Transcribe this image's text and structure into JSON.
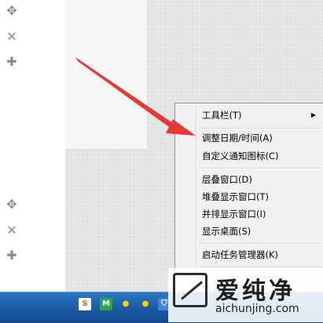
{
  "left_strip": {
    "icons": [
      "move-icon",
      "close-icon",
      "plus-icon",
      "move-icon",
      "close-icon",
      "plus-icon"
    ]
  },
  "context_menu": {
    "items": [
      {
        "label": "工具栏(T)",
        "has_submenu": true
      },
      {
        "label": "调整日期/时间(A)"
      },
      {
        "label": "自定义通知图标(C)"
      },
      {
        "label": "层叠窗口(D)"
      },
      {
        "label": "堆叠显示窗口(T)"
      },
      {
        "label": "并排显示窗口(I)"
      },
      {
        "label": "显示桌面(S)"
      },
      {
        "label": "启动任务管理器(K)"
      }
    ]
  },
  "annotation": {
    "arrow_color": "#e53935"
  },
  "taskbar": {
    "color": "#1e63b0",
    "tray_icons": [
      "sogou-ime-icon",
      "security-icon",
      "penguin-icon",
      "penguin-icon",
      "shield-icon"
    ]
  },
  "watermark": {
    "title": "爱纯净",
    "url": "aichunjing.com"
  }
}
